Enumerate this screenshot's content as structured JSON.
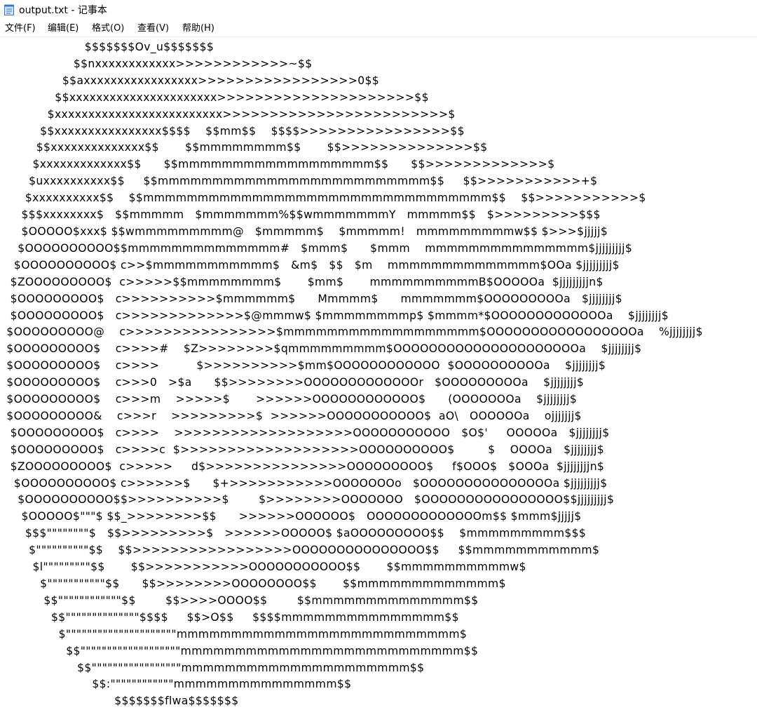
{
  "window": {
    "title": "output.txt - 记事本"
  },
  "menu": [
    {
      "label": "文件(F)"
    },
    {
      "label": "编辑(E)"
    },
    {
      "label": "格式(O)"
    },
    {
      "label": "查看(V)"
    },
    {
      "label": "帮助(H)"
    }
  ],
  "editor": {
    "lines": [
      "                      $$$$$$$Ov_u$$$$$$$",
      "                   $$nxxxxxxxxxxxx>>>>>>>>>>>>~$$",
      "                $$axxxxxxxxxxxxxxxxx>>>>>>>>>>>>>>>>>0$$",
      "              $$xxxxxxxxxxxxxxxxxxxxxx>>>>>>>>>>>>>>>>>>>>>$$",
      "            $xxxxxxxxxxxxxxxxxxxxxxxxx>>>>>>>>>>>>>>>>>>>>>>>>$",
      "          $$xxxxxxxxxxxxxxxx$$$$    $$mm$$    $$$$>>>>>>>>>>>>>>>>$$",
      "         $$xxxxxxxxxxxxxx$$       $$mmmmmmmm$$       $$>>>>>>>>>>>>>>$$",
      "        $xxxxxxxxxxxxx$$      $$mmmmmmmmmmmmmmmmmm$$      $$>>>>>>>>>>>>>$",
      "       $uxxxxxxxxxx$$     $$mmmmmmmmmmmmmmmmmmmmmmmmm$$     $$>>>>>>>>>>>+$",
      "      $xxxxxxxxxx$$    $$mmmmmmmmmmmmmmmmmmmmmmmmmmmmmmmm$$    $$>>>>>>>>>>>$",
      "     $$$xxxxxxxx$   $$mmmmm   $mmmmmmm%$$wmmmmmmmY   mmmmm$$   $>>>>>>>>>$$$",
      "     $OOOOO$xxx$ $$wmmmmmmmmm@   $mmmmm$    $mmmmm!   mmmmmmmmmw$$ $>>>$jjjjj$",
      "    $OOOOOOOOOO$$mmmmmmmmmmmmmm#   $mmm$      $mmm    mmmmmmmmmmmmmmm$jjjjjjjjj$",
      "   $OOOOOOOOOO$ c>>$mmmmmmmmmmm$   &m$   $$   $m    mmmmmmmmmmmmmm$OOa $jjjjjjjjj$",
      "  $ZOOOOOOOOO$  c>>>>>$$mmmmmmmm$       $mm$       mmmmmmmmmmB$OOOOOa  $jjjjjjjjjn$",
      "  $OOOOOOOOO$   c>>>>>>>>>>$mmmmmm$      Mmmmm$      mmmmmmm$OOOOOOOOOa   $jjjjjjjj$",
      "  $OOOOOOOOO$   c>>>>>>>>>>>>>$@mmmw$ $mmmmmmmmp$ $mmmm*$OOOOOOOOOOOOOa    $jjjjjjjj$",
      " $OOOOOOOOO@    c>>>>>>>>>>>>>>>>$mmmmmmmmmmmmmmmmmm$OOOOOOOOOOOOOOOOOa    %jjjjjjjj$",
      " $OOOOOOOOO$    c>>>>#    $Z>>>>>>>>$qmmmmmmmmm$OOOOOOOOOOOOOOOOOOOOOa    $jjjjjjjj$",
      " $OOOOOOOOO$    c>>>>          $>>>>>>>>>>$mm$OOOOOOOOOOOO  $OOOOOOOOOOa    $jjjjjjjj$",
      " $OOOOOOOOO$    c>>>0   >$a      $$>>>>>>>>OOOOOOOOOOOOOr   $OOOOOOOOOa    $jjjjjjjj$",
      " $OOOOOOOOO$    c>>>m    >>>>>$       >>>>>>OOOOOOOOOOOO$      (OOOOOOOa    $jjjjjjjj$",
      " $OOOOOOOOO&    c>>>r    >>>>>>>>>$  >>>>>>OOOOOOOOOOO$  aO\\   OOOOOOa    ojjjjjjj$",
      "  $OOOOOOOOO$   c>>>>    >>>>>>>>>>>>>>>>>>>OOOOOOOOOOO   $O$'     OOOOOa   $jjjjjjjj$",
      "  $OOOOOOOOO$   c>>>>c  $>>>>>>>>>>>>>>>>>>>OOOOOOOOOO$         $    OOOOa   $jjjjjjjj$",
      "  $ZOOOOOOOOO$  c>>>>>     d$>>>>>>>>>>>>>>>OOOOOOOOO$     f$OOO$   $OOOa  $jjjjjjjjn$",
      "   $OOOOOOOOOO$ c>>>>>>$      $+>>>>>>>>>>>OOOOOOOo   $OOOOOOOOOOOOOOOa $jjjjjjjjj$",
      "    $OOOOOOOOOO$$>>>>>>>>>>$        $>>>>>>>>OOOOOOO   $OOOOOOOOOOOOOOOO$$jjjjjjjjj$",
      "     $OOOOO$\"\"\"$ $$_>>>>>>>>$$      >>>>>>OOOOOO$   OOOOOOOOOOOOOm$$ $mmm$jjjjj$",
      "      $$$\"\"\"\"\"\"\"\"$   $$>>>>>>>>>$   >>>>>>OOOOO$ $aOOOOOOOOO$$    $mmmmmmmmm$$$",
      "       $\"\"\"\"\"\"\"\"\"\"$$    $$>>>>>>>>>>>>>>>>>OOOOOOOOOOOOOOO$$     $$mmmmmmmmmmm$",
      "        $l\"\"\"\"\"\"\"\"\"$$       $$>>>>>>>>>>>OOOOOOOOOOO$$       $$mmmmmmmmmmw$",
      "          $\"\"\"\"\"\"\"\"\"\"\"$$      $$>>>>>>>>OOOOOOOO$$       $$mmmmmmmmmmmmm$",
      "           $$\"\"\"\"\"\"\"\"\"\"\"\"$$        $$>>>>OOOO$$        $$mmmmmmmmmmmmmm$$",
      "             $$\"\"\"\"\"\"\"\"\"\"\"\"\"\"$$$$     $$>O$$     $$$$mmmmmmmmmmmmmmm$$",
      "               $\"\"\"\"\"\"\"\"\"\"\"\"\"\"\"\"\"\"\"\"\"mmmmmmmmmmmmmmmmmmmmmmmmmm$",
      "                 $$\"\"\"\"\"\"\"\"\"\"\"\"\"\"\"\"\"\"\"mmmmmmmmmmmmmmmmmmmmmmmmmm$$",
      "                    $$\"\"\"\"\"\"\"\"\"\"\"\"\"\"\"\"\"mmmmmmmmmmmmmmmmmmmmm$$",
      "                        $$:\"\"\"\"\"\"\"\"\"\"\"\"mmmmmmmmmmmmmmm$$",
      "                              $$$$$$$flwa$$$$$$$"
    ]
  }
}
